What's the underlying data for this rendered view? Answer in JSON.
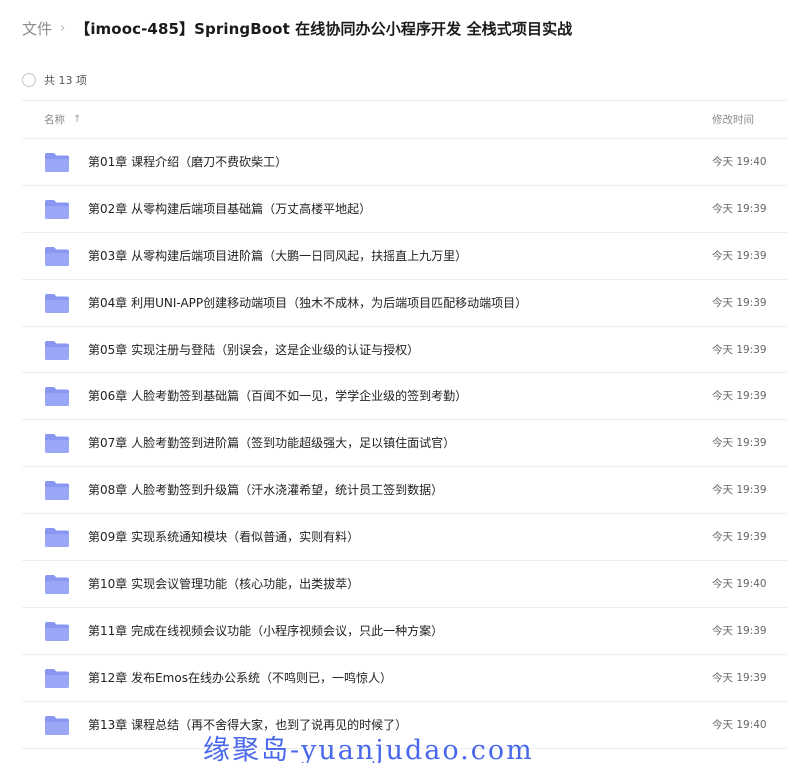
{
  "breadcrumb": {
    "root": "文件",
    "separator": "›",
    "current": "【imooc-485】SpringBoot 在线协同办公小程序开发 全栈式项目实战"
  },
  "summary": {
    "count_text": "共 13 项"
  },
  "table": {
    "header_name": "名称",
    "header_time": "修改时间",
    "sort_icon": "↑",
    "rows": [
      {
        "name": "第01章 课程介绍（磨刀不费砍柴工）",
        "time": "今天 19:40"
      },
      {
        "name": "第02章 从零构建后端项目基础篇（万丈高楼平地起）",
        "time": "今天 19:39"
      },
      {
        "name": "第03章 从零构建后端项目进阶篇（大鹏一日同风起，扶摇直上九万里）",
        "time": "今天 19:39"
      },
      {
        "name": "第04章 利用UNI-APP创建移动端项目（独木不成林，为后端项目匹配移动端项目）",
        "time": "今天 19:39"
      },
      {
        "name": "第05章 实现注册与登陆（别误会，这是企业级的认证与授权）",
        "time": "今天 19:39"
      },
      {
        "name": "第06章 人脸考勤签到基础篇（百闻不如一见，学学企业级的签到考勤）",
        "time": "今天 19:39"
      },
      {
        "name": "第07章 人脸考勤签到进阶篇（签到功能超级强大，足以镇住面试官）",
        "time": "今天 19:39"
      },
      {
        "name": "第08章 人脸考勤签到升级篇（汗水浇灌希望，统计员工签到数据）",
        "time": "今天 19:39"
      },
      {
        "name": "第09章 实现系统通知模块（看似普通，实则有料）",
        "time": "今天 19:39"
      },
      {
        "name": "第10章 实现会议管理功能（核心功能，出类拔萃）",
        "time": "今天 19:40"
      },
      {
        "name": "第11章 完成在线视频会议功能（小程序视频会议，只此一种方案）",
        "time": "今天 19:39"
      },
      {
        "name": "第12章 发布Emos在线办公系统（不鸣则已，一鸣惊人）",
        "time": "今天 19:39"
      },
      {
        "name": "第13章 课程总结（再不舍得大家，也到了说再见的时候了）",
        "time": "今天 19:40"
      }
    ]
  },
  "icons": {
    "folder": "folder-icon",
    "folder_color": "#8a97f2"
  },
  "watermark": {
    "text": "缘聚岛-yuanjudao.com",
    "color": "#2a4eea"
  }
}
